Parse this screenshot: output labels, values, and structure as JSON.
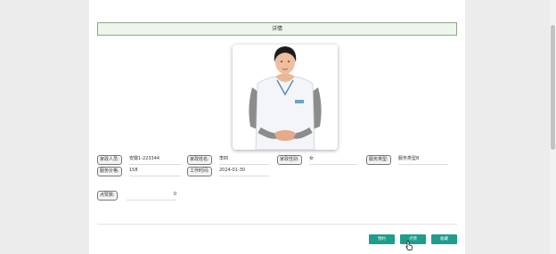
{
  "detail": {
    "title": "详情"
  },
  "fields": {
    "name_label": "家政人员:",
    "name_value": "安徽1-223344",
    "surname_label": "家政姓名:",
    "surname_value": "李四",
    "gender_label": "家政性别:",
    "gender_value": "女",
    "service_type_label": "服务类型:",
    "service_type_value": "服务类型8",
    "price_label": "服务价格:",
    "price_value": "158",
    "work_time_label": "工作时间:",
    "work_time_value": "2024-01-30",
    "clicks_label": "点赞数:",
    "clicks_value": "0"
  },
  "actions": {
    "book_label": "预约",
    "like_label": "点赞",
    "favorite_label": "收藏"
  },
  "colors": {
    "button": "#1e9d8c",
    "title_bg": "#eef5ea"
  },
  "icons": {
    "cursor": "pointer-cursor-icon"
  }
}
